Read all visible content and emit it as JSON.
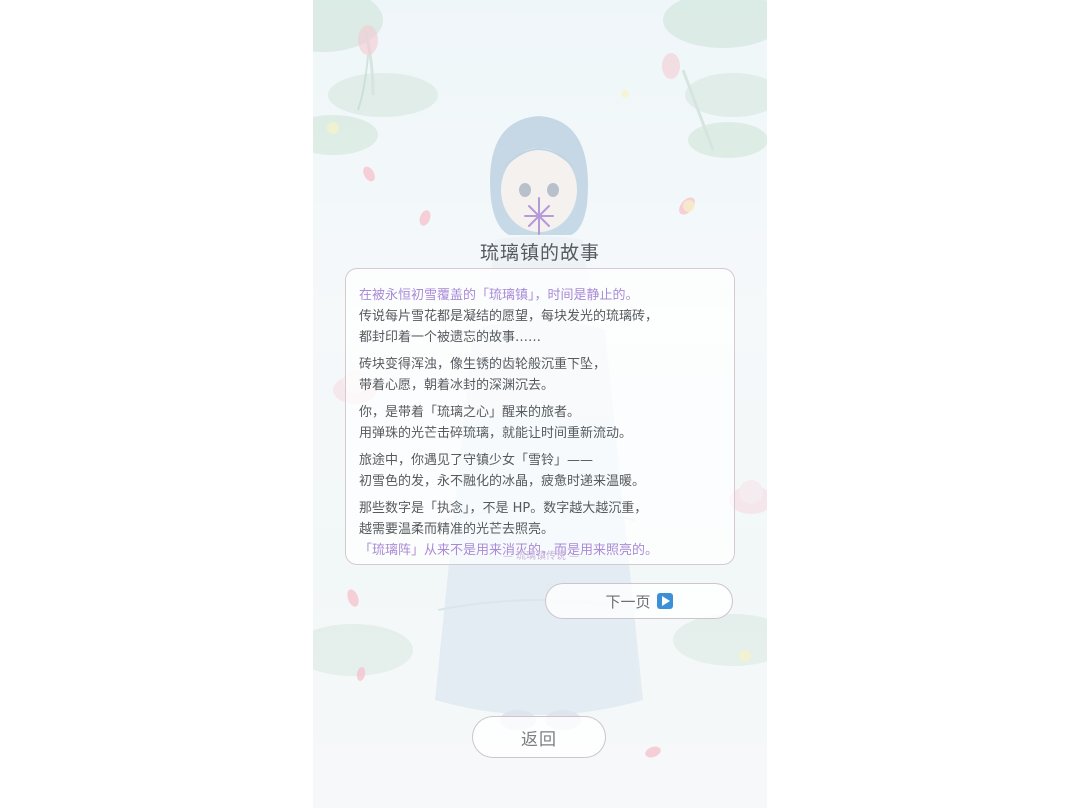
{
  "story": {
    "title": "琉璃镇的故事",
    "paragraphs": [
      {
        "lines": [
          {
            "text": "在被永恒初雪覆盖的「琉璃镇」，时间是静止的。",
            "accent": true
          },
          {
            "text": "传说每片雪花都是凝结的愿望，每块发光的琉璃砖，",
            "accent": false
          },
          {
            "text": "都封印着一个被遗忘的故事……",
            "accent": false
          }
        ]
      },
      {
        "lines": [
          {
            "text": "砖块变得浑浊，像生锈的齿轮般沉重下坠，",
            "accent": false
          },
          {
            "text": "带着心愿，朝着冰封的深渊沉去。",
            "accent": false
          }
        ]
      },
      {
        "lines": [
          {
            "text": "你，是带着「琉璃之心」醒来的旅者。",
            "accent": false
          },
          {
            "text": "用弹珠的光芒击碎琉璃，就能让时间重新流动。",
            "accent": false
          }
        ]
      },
      {
        "lines": [
          {
            "text": "旅途中，你遇见了守镇少女「雪铃」——",
            "accent": false
          },
          {
            "text": "初雪色的发，永不融化的冰晶，疲惫时递来温暖。",
            "accent": false
          }
        ]
      },
      {
        "lines": [
          {
            "text": "那些数字是「执念」，不是 HP。数字越大越沉重，",
            "accent": false
          },
          {
            "text": "越需要温柔而精准的光芒去照亮。",
            "accent": false
          },
          {
            "text": "「琉璃阵」从来不是用来消灭的，而是用来照亮的。",
            "accent": true
          }
        ]
      }
    ],
    "signature": "— 琉璃镇传说 —"
  },
  "buttons": {
    "next_label": "下一页",
    "next_icon": "play-icon",
    "back_label": "返回"
  },
  "colors": {
    "accent": "#a98ad6",
    "text": "#555a5e",
    "next_icon_bg": "#3d8fd6"
  }
}
